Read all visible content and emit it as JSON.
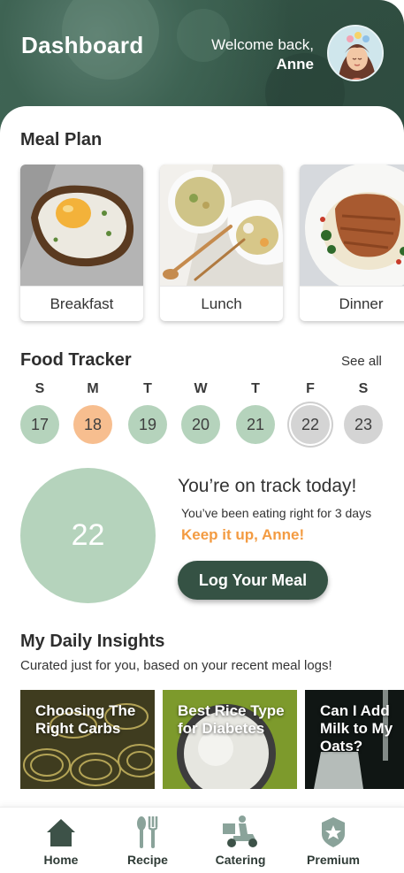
{
  "header": {
    "title": "Dashboard",
    "welcome": "Welcome back,",
    "user_name": "Anne"
  },
  "meal_plan": {
    "title": "Meal Plan",
    "items": [
      {
        "label": "Breakfast"
      },
      {
        "label": "Lunch"
      },
      {
        "label": "Dinner"
      }
    ]
  },
  "food_tracker": {
    "title": "Food Tracker",
    "see_all": "See all",
    "days": [
      {
        "letter": "S",
        "date": "17"
      },
      {
        "letter": "M",
        "date": "18"
      },
      {
        "letter": "T",
        "date": "19"
      },
      {
        "letter": "W",
        "date": "20"
      },
      {
        "letter": "T",
        "date": "21"
      },
      {
        "letter": "F",
        "date": "22"
      },
      {
        "letter": "S",
        "date": "23"
      }
    ],
    "big_date": "22",
    "status": "You’re on track today!",
    "streak": "You’ve been eating right for 3 days",
    "encouragement": "Keep it up, Anne!",
    "log_button": "Log Your Meal"
  },
  "insights": {
    "title": "My Daily Insights",
    "subtitle": "Curated just for you, based on your recent meal logs!",
    "cards": [
      {
        "title": "Choosing The Right Carbs"
      },
      {
        "title": "Best Rice Type for Diabetes"
      },
      {
        "title": "Can I Add Milk to My Oats?"
      }
    ]
  },
  "nav": {
    "items": [
      {
        "label": "Home",
        "icon": "home-icon"
      },
      {
        "label": "Recipe",
        "icon": "utensils-icon"
      },
      {
        "label": "Catering",
        "icon": "delivery-scooter-icon"
      },
      {
        "label": "Premium",
        "icon": "premium-badge-icon"
      }
    ]
  },
  "colors": {
    "accent": "#355244",
    "tracker_green": "#b5d3bc",
    "highlight_orange": "#f7be8f",
    "keep_orange": "#f39b42"
  }
}
